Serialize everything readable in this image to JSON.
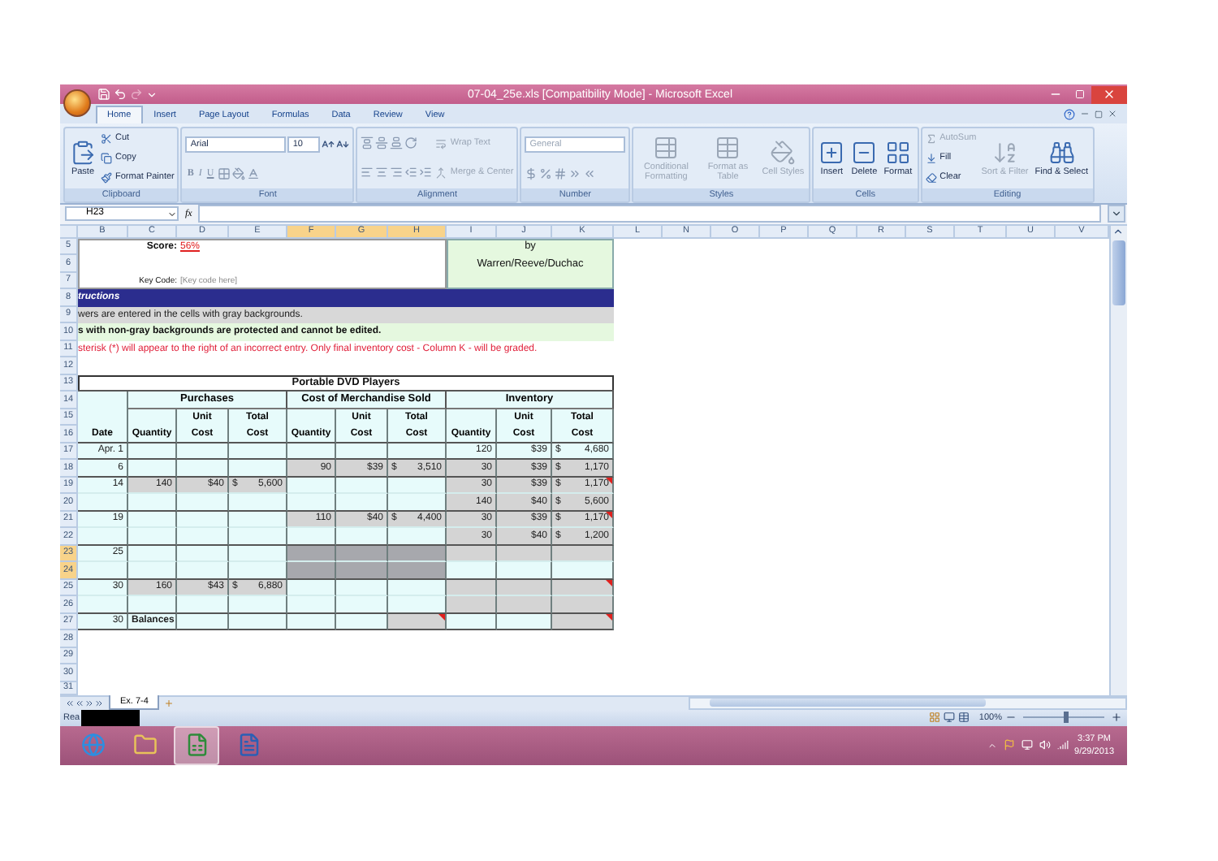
{
  "window": {
    "title": "07-04_25e.xls  [Compatibility Mode] - Microsoft Excel"
  },
  "ribbon_tabs": [
    {
      "label": "Home",
      "selected": true
    },
    {
      "label": "Insert",
      "selected": false
    },
    {
      "label": "Page Layout",
      "selected": false
    },
    {
      "label": "Formulas",
      "selected": false
    },
    {
      "label": "Data",
      "selected": false
    },
    {
      "label": "Review",
      "selected": false
    },
    {
      "label": "View",
      "selected": false
    }
  ],
  "ribbon_groups": [
    {
      "label": "Clipboard",
      "columns": [
        [
          [
            {
              "kind": "large",
              "label": "Paste",
              "disabled": false
            }
          ]
        ],
        [
          [
            {
              "kind": "small",
              "label": "Cut",
              "disabled": false
            }
          ],
          [
            {
              "kind": "small",
              "label": "Copy",
              "disabled": false
            }
          ],
          [
            {
              "kind": "small",
              "label": "Format Painter",
              "disabled": false
            }
          ]
        ]
      ]
    },
    {
      "label": "Font",
      "columns": [
        [
          [
            {
              "kind": "field",
              "label": "Arial",
              "disabled": false
            },
            {
              "kind": "field",
              "label": "10",
              "disabled": false
            },
            {
              "kind": "tool",
              "disabled": false
            },
            {
              "kind": "tool",
              "disabled": false
            }
          ],
          [
            {
              "kind": "glyph",
              "label": "B",
              "disabled": true
            },
            {
              "kind": "glyph",
              "label": "I",
              "disabled": true
            },
            {
              "kind": "glyph",
              "label": "U",
              "disabled": true
            },
            {
              "kind": "tool",
              "disabled": true
            },
            {
              "kind": "tool",
              "disabled": true
            },
            {
              "kind": "tool",
              "disabled": true
            }
          ]
        ]
      ]
    },
    {
      "label": "Alignment",
      "columns": [
        [
          [
            {
              "kind": "tool",
              "disabled": true
            },
            {
              "kind": "tool",
              "disabled": true
            },
            {
              "kind": "tool",
              "disabled": true
            },
            {
              "kind": "tool",
              "disabled": true
            }
          ],
          [
            {
              "kind": "tool",
              "disabled": true
            },
            {
              "kind": "tool",
              "disabled": true
            },
            {
              "kind": "tool",
              "disabled": true
            },
            {
              "kind": "tool",
              "disabled": true
            },
            {
              "kind": "tool",
              "disabled": true
            }
          ]
        ],
        [
          [
            {
              "kind": "small",
              "label": "Wrap Text",
              "disabled": true
            }
          ],
          [
            {
              "kind": "small",
              "label": "Merge & Center",
              "disabled": true
            }
          ]
        ]
      ]
    },
    {
      "label": "Number",
      "columns": [
        [
          [
            {
              "kind": "field",
              "label": "General",
              "disabled": true
            }
          ],
          [
            {
              "kind": "tool",
              "disabled": true
            },
            {
              "kind": "tool",
              "disabled": true
            },
            {
              "kind": "tool",
              "disabled": true
            },
            {
              "kind": "tool",
              "disabled": true
            },
            {
              "kind": "tool",
              "disabled": true
            }
          ]
        ]
      ]
    },
    {
      "label": "Styles",
      "columns": [
        [
          [
            {
              "kind": "large",
              "label": "Conditional Formatting",
              "disabled": true
            }
          ]
        ],
        [
          [
            {
              "kind": "large",
              "label": "Format as Table",
              "disabled": true
            }
          ]
        ],
        [
          [
            {
              "kind": "large",
              "label": "Cell Styles",
              "disabled": true
            }
          ]
        ]
      ]
    },
    {
      "label": "Cells",
      "columns": [
        [
          [
            {
              "kind": "large",
              "label": "Insert",
              "disabled": false
            }
          ]
        ],
        [
          [
            {
              "kind": "large",
              "label": "Delete",
              "disabled": false
            }
          ]
        ],
        [
          [
            {
              "kind": "large",
              "label": "Format",
              "disabled": false
            }
          ]
        ]
      ]
    },
    {
      "label": "Editing",
      "columns": [
        [
          [
            {
              "kind": "small",
              "label": "AutoSum",
              "disabled": true
            }
          ],
          [
            {
              "kind": "small",
              "label": "Fill",
              "disabled": false
            }
          ],
          [
            {
              "kind": "small",
              "label": "Clear",
              "disabled": false
            }
          ]
        ],
        [
          [
            {
              "kind": "large",
              "label": "Sort & Filter",
              "disabled": true
            }
          ]
        ],
        [
          [
            {
              "kind": "large",
              "label": "Find & Select",
              "disabled": false
            }
          ]
        ]
      ]
    }
  ],
  "formula_bar": {
    "name_box": "H23",
    "function_label": "fx"
  },
  "sheet_columns": [
    {
      "label": "B",
      "selected": false
    },
    {
      "label": "C",
      "selected": false
    },
    {
      "label": "D",
      "selected": false
    },
    {
      "label": "E",
      "selected": false
    },
    {
      "label": "F",
      "selected": true
    },
    {
      "label": "G",
      "selected": true
    },
    {
      "label": "H",
      "selected": true
    },
    {
      "label": "I",
      "selected": false
    },
    {
      "label": "J",
      "selected": false
    },
    {
      "label": "K",
      "selected": false
    },
    {
      "label": "L",
      "selected": false
    },
    {
      "label": "N",
      "selected": false
    },
    {
      "label": "O",
      "selected": false
    },
    {
      "label": "P",
      "selected": false
    },
    {
      "label": "Q",
      "selected": false
    },
    {
      "label": "R",
      "selected": false
    },
    {
      "label": "S",
      "selected": false
    },
    {
      "label": "T",
      "selected": false
    },
    {
      "label": "U",
      "selected": false
    },
    {
      "label": "V",
      "selected": false
    }
  ],
  "sheet_rows": [
    {
      "label": "5",
      "selected": false
    },
    {
      "label": "6",
      "selected": false
    },
    {
      "label": "7",
      "selected": false
    },
    {
      "label": "8",
      "selected": false
    },
    {
      "label": "9",
      "selected": false
    },
    {
      "label": "10",
      "selected": false
    },
    {
      "label": "11",
      "selected": false
    },
    {
      "label": "12",
      "selected": false
    },
    {
      "label": "13",
      "selected": false
    },
    {
      "label": "14",
      "selected": false
    },
    {
      "label": "15",
      "selected": false
    },
    {
      "label": "16",
      "selected": false
    },
    {
      "label": "17",
      "selected": false
    },
    {
      "label": "18",
      "selected": false
    },
    {
      "label": "19",
      "selected": false
    },
    {
      "label": "20",
      "selected": false
    },
    {
      "label": "21",
      "selected": false
    },
    {
      "label": "22",
      "selected": false
    },
    {
      "label": "23",
      "selected": true
    },
    {
      "label": "24",
      "selected": true
    },
    {
      "label": "25",
      "selected": false
    },
    {
      "label": "26",
      "selected": false
    },
    {
      "label": "27",
      "selected": false
    },
    {
      "label": "28",
      "selected": false
    },
    {
      "label": "29",
      "selected": false
    },
    {
      "label": "30",
      "selected": false
    },
    {
      "label": "31",
      "selected": false
    }
  ],
  "score": {
    "label": "Score:",
    "value": "56%",
    "key_label": "Key Code:",
    "key_value": "[Key code here]"
  },
  "author": [
    "by",
    "Warren/Reeve/Duchac"
  ],
  "instructions": {
    "title": "tructions",
    "lines": [
      {
        "kind": "gray",
        "text": "wers are entered in the cells with gray backgrounds."
      },
      {
        "kind": "green",
        "text": "s with non-gray backgrounds are protected and cannot be edited."
      },
      {
        "kind": "red",
        "text": "sterisk (*) will appear to the right of an incorrect entry. Only final inventory cost - Column K - will be graded."
      }
    ]
  },
  "table": {
    "title": "Portable DVD Players",
    "date_header": "Date",
    "groups": [
      "Purchases",
      "Cost of Merchandise Sold",
      "Inventory"
    ],
    "headers": [
      [
        "Quantity"
      ],
      [
        "Unit",
        "Cost"
      ],
      [
        "Total",
        "Cost"
      ],
      [
        "Quantity"
      ],
      [
        "Unit",
        "Cost"
      ],
      [
        "Total",
        "Cost"
      ],
      [
        "Quantity"
      ],
      [
        "Unit",
        "Cost"
      ],
      [
        "Total",
        "Cost"
      ]
    ],
    "rows": [
      {
        "rule": true,
        "cells": [
          {
            "text": "Apr. 1",
            "input": false,
            "selected": false
          },
          {
            "input": false,
            "selected": false
          },
          {
            "input": false,
            "selected": false
          },
          {
            "input": false,
            "selected": false
          },
          {
            "input": false,
            "selected": false
          },
          {
            "input": false,
            "selected": false
          },
          {
            "input": false,
            "selected": false
          },
          {
            "text": "120",
            "input": false,
            "selected": false
          },
          {
            "text": "$39",
            "input": false,
            "selected": false
          },
          {
            "sign": "$",
            "text": "4,680",
            "input": false,
            "selected": false
          }
        ]
      },
      {
        "rule": true,
        "cells": [
          {
            "text": "6",
            "input": false,
            "selected": false
          },
          {
            "input": false,
            "selected": false
          },
          {
            "input": false,
            "selected": false
          },
          {
            "input": false,
            "selected": false
          },
          {
            "text": "90",
            "input": true,
            "selected": false
          },
          {
            "text": "$39",
            "input": true,
            "selected": false
          },
          {
            "sign": "$",
            "text": "3,510",
            "input": true,
            "selected": false
          },
          {
            "text": "30",
            "input": true,
            "selected": false
          },
          {
            "text": "$39",
            "input": true,
            "selected": false
          },
          {
            "sign": "$",
            "text": "1,170",
            "input": true,
            "selected": false
          }
        ]
      },
      {
        "rule": false,
        "cells": [
          {
            "text": "14",
            "input": false,
            "selected": false
          },
          {
            "text": "140",
            "input": true,
            "selected": false
          },
          {
            "text": "$40",
            "input": true,
            "selected": false
          },
          {
            "sign": "$",
            "text": "5,600",
            "input": true,
            "selected": false
          },
          {
            "input": false,
            "selected": false
          },
          {
            "input": false,
            "selected": false
          },
          {
            "input": false,
            "selected": false
          },
          {
            "text": "30",
            "input": true,
            "selected": false
          },
          {
            "text": "$39",
            "input": true,
            "selected": false
          },
          {
            "sign": "$",
            "text": "1,170",
            "input": true,
            "selected": false,
            "flag": true
          }
        ]
      },
      {
        "rule": true,
        "cells": [
          {
            "input": false,
            "selected": false
          },
          {
            "input": false,
            "selected": false
          },
          {
            "input": false,
            "selected": false
          },
          {
            "input": false,
            "selected": false
          },
          {
            "input": false,
            "selected": false
          },
          {
            "input": false,
            "selected": false
          },
          {
            "input": false,
            "selected": false
          },
          {
            "text": "140",
            "input": true,
            "selected": false
          },
          {
            "text": "$40",
            "input": true,
            "selected": false
          },
          {
            "sign": "$",
            "text": "5,600",
            "input": true,
            "selected": false
          }
        ]
      },
      {
        "rule": false,
        "cells": [
          {
            "text": "19",
            "input": false,
            "selected": false
          },
          {
            "input": false,
            "selected": false
          },
          {
            "input": false,
            "selected": false
          },
          {
            "input": false,
            "selected": false
          },
          {
            "text": "110",
            "input": true,
            "selected": false
          },
          {
            "text": "$40",
            "input": true,
            "selected": false
          },
          {
            "sign": "$",
            "text": "4,400",
            "input": true,
            "selected": false
          },
          {
            "text": "30",
            "input": true,
            "selected": false
          },
          {
            "text": "$39",
            "input": true,
            "selected": false
          },
          {
            "sign": "$",
            "text": "1,170",
            "input": true,
            "selected": false,
            "flag": true
          }
        ]
      },
      {
        "rule": true,
        "cells": [
          {
            "input": false,
            "selected": false
          },
          {
            "input": false,
            "selected": false
          },
          {
            "input": false,
            "selected": false
          },
          {
            "input": false,
            "selected": false
          },
          {
            "input": false,
            "selected": false
          },
          {
            "input": false,
            "selected": false
          },
          {
            "input": false,
            "selected": false
          },
          {
            "text": "30",
            "input": true,
            "selected": false
          },
          {
            "text": "$40",
            "input": true,
            "selected": false
          },
          {
            "sign": "$",
            "text": "1,200",
            "input": true,
            "selected": false
          }
        ]
      },
      {
        "rule": false,
        "cells": [
          {
            "text": "25",
            "input": false,
            "selected": false
          },
          {
            "input": false,
            "selected": false
          },
          {
            "input": false,
            "selected": false
          },
          {
            "input": false,
            "selected": false
          },
          {
            "input": true,
            "selected": true
          },
          {
            "input": true,
            "selected": true
          },
          {
            "input": true,
            "selected": true
          },
          {
            "input": true,
            "selected": false
          },
          {
            "input": true,
            "selected": false
          },
          {
            "input": true,
            "selected": false
          }
        ]
      },
      {
        "rule": true,
        "cells": [
          {
            "input": false,
            "selected": false
          },
          {
            "input": false,
            "selected": false
          },
          {
            "input": false,
            "selected": false
          },
          {
            "input": false,
            "selected": false
          },
          {
            "input": true,
            "selected": true
          },
          {
            "input": true,
            "selected": true
          },
          {
            "input": true,
            "selected": true
          },
          {
            "input": false,
            "selected": false
          },
          {
            "input": false,
            "selected": false
          },
          {
            "input": false,
            "selected": false
          }
        ]
      },
      {
        "rule": false,
        "cells": [
          {
            "text": "30",
            "input": false,
            "selected": false
          },
          {
            "text": "160",
            "input": true,
            "selected": false
          },
          {
            "text": "$43",
            "input": true,
            "selected": false
          },
          {
            "sign": "$",
            "text": "6,880",
            "input": true,
            "selected": false
          },
          {
            "input": false,
            "selected": false
          },
          {
            "input": false,
            "selected": false
          },
          {
            "input": false,
            "selected": false
          },
          {
            "input": true,
            "selected": false
          },
          {
            "input": true,
            "selected": false
          },
          {
            "input": true,
            "selected": false,
            "flag": true
          }
        ]
      },
      {
        "rule": true,
        "cells": [
          {
            "input": false,
            "selected": false
          },
          {
            "input": false,
            "selected": false
          },
          {
            "input": false,
            "selected": false
          },
          {
            "input": false,
            "selected": false
          },
          {
            "input": false,
            "selected": false
          },
          {
            "input": false,
            "selected": false
          },
          {
            "input": false,
            "selected": false
          },
          {
            "input": true,
            "selected": false
          },
          {
            "input": true,
            "selected": false
          },
          {
            "input": true,
            "selected": false
          }
        ]
      },
      {
        "rule": true,
        "cells": [
          {
            "text": "30",
            "input": false,
            "selected": false
          },
          {
            "text": "Balances",
            "input": false,
            "selected": false,
            "strong": true
          },
          {
            "input": false,
            "selected": false
          },
          {
            "input": false,
            "selected": false
          },
          {
            "input": false,
            "selected": false
          },
          {
            "input": false,
            "selected": false
          },
          {
            "input": true,
            "selected": false,
            "flag": true
          },
          {
            "input": false,
            "selected": false
          },
          {
            "input": false,
            "selected": false
          },
          {
            "input": true,
            "selected": false,
            "flag": true
          }
        ]
      }
    ]
  },
  "sheet_tabs": [
    {
      "label": "Ex. 7-4",
      "selected": true
    }
  ],
  "status_bar": {
    "text": "Rea",
    "zoom": "100%",
    "zoom_slider": {
      "level": 0.5
    }
  },
  "taskbar": {
    "apps": [
      {
        "selected": false
      },
      {
        "selected": false
      },
      {
        "selected": true
      },
      {
        "selected": false
      }
    ],
    "time": "3:37 PM",
    "date": "9/29/2013"
  }
}
